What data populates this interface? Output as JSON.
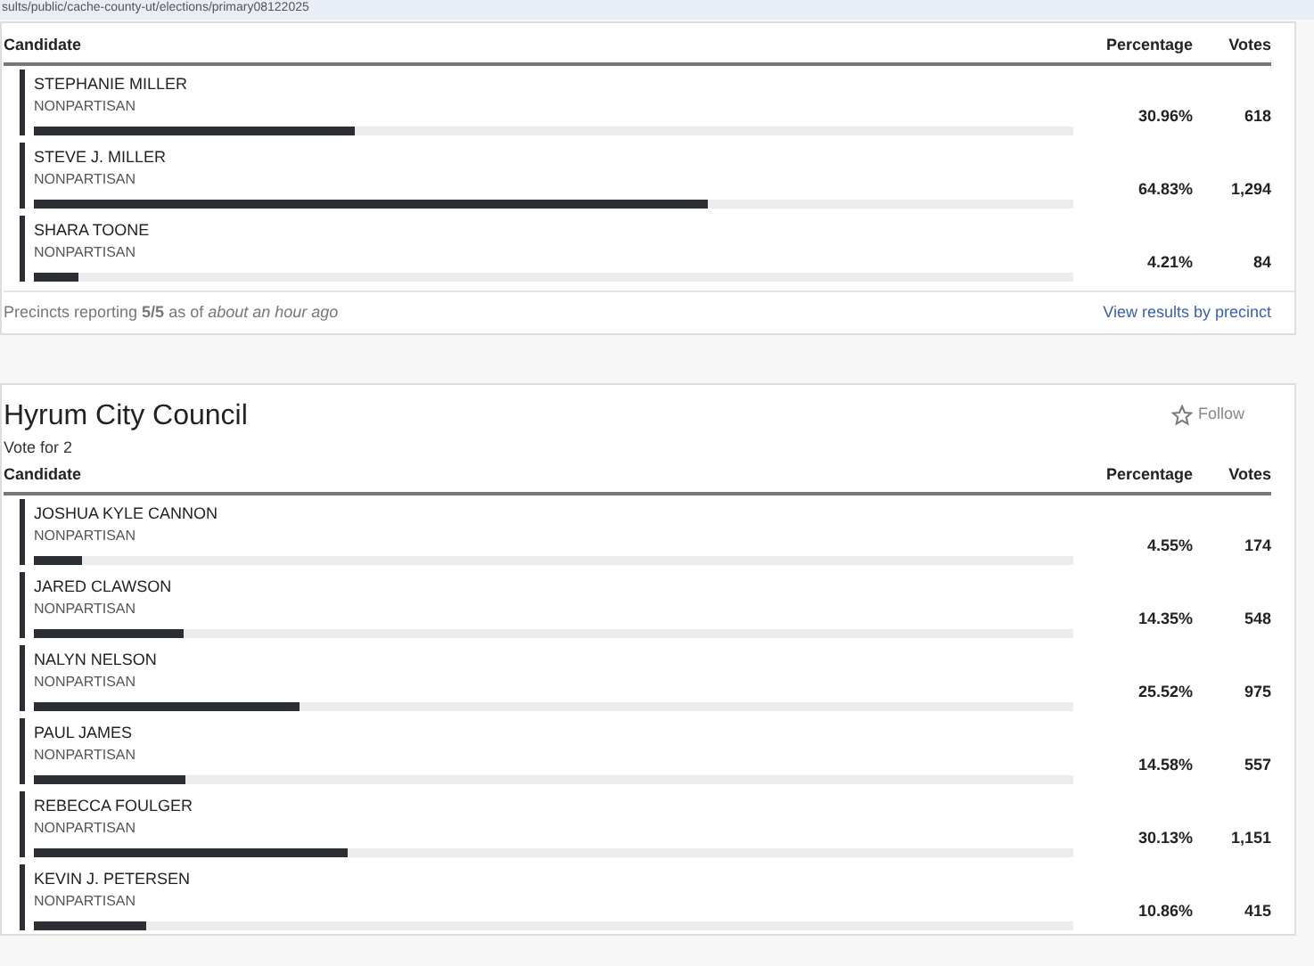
{
  "address_bar": {
    "url": "sults/public/cache-county-ut/elections/primary08122025"
  },
  "races": [
    {
      "columns": [
        "Candidate",
        "Percentage",
        "Votes"
      ],
      "candidates": [
        {
          "name": "STEPHANIE MILLER",
          "party": "NONPARTISAN",
          "level": 0.3096,
          "percentage": "30.96%",
          "votes": "618"
        },
        {
          "name": "STEVE J. MILLER",
          "party": "NONPARTISAN",
          "level": 0.6483,
          "percentage": "64.83%",
          "votes": "1,294"
        },
        {
          "name": "SHARA TOONE",
          "party": "NONPARTISAN",
          "level": 0.0421,
          "percentage": "4.21%",
          "votes": "84"
        }
      ],
      "footer": {
        "status": "Precincts reporting **5/5** as of *about an hour ago*",
        "link": "View results by precinct"
      }
    },
    {
      "title": "Hyrum City Council",
      "subtitle": "Vote for 2",
      "follow": "Follow",
      "columns": [
        "Candidate",
        "Percentage",
        "Votes"
      ],
      "candidates": [
        {
          "name": "JOSHUA KYLE CANNON",
          "party": "NONPARTISAN",
          "level": 0.0455,
          "percentage": "4.55%",
          "votes": "174"
        },
        {
          "name": "JARED CLAWSON",
          "party": "NONPARTISAN",
          "level": 0.1435,
          "percentage": "14.35%",
          "votes": "548"
        },
        {
          "name": "NALYN NELSON",
          "party": "NONPARTISAN",
          "level": 0.2552,
          "percentage": "25.52%",
          "votes": "975"
        },
        {
          "name": "PAUL JAMES",
          "party": "NONPARTISAN",
          "level": 0.1458,
          "percentage": "14.58%",
          "votes": "557"
        },
        {
          "name": "REBECCA FOULGER",
          "party": "NONPARTISAN",
          "level": 0.3013,
          "percentage": "30.13%",
          "votes": "1,151"
        },
        {
          "name": "KEVIN J. PETERSEN",
          "party": "NONPARTISAN",
          "level": 0.1086,
          "percentage": "10.86%",
          "votes": "415"
        }
      ]
    }
  ]
}
